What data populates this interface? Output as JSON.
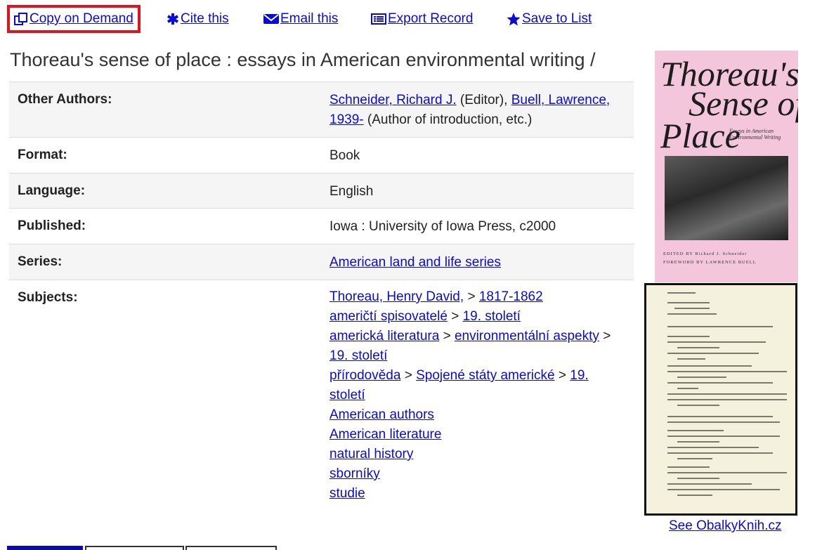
{
  "toolbar": {
    "copy_label": "Copy on Demand",
    "cite_label": "Cite this",
    "email_label": "Email this",
    "export_label": "Export Record",
    "save_label": "Save to List"
  },
  "record": {
    "title": "Thoreau's sense of place : essays in American environmental writing /",
    "other_authors_label": "Other Authors:",
    "author1": "Schneider, Richard J.",
    "author1_role": "(Editor),",
    "author2": "Buell, Lawrence, 1939-",
    "author2_role": "(Author of introduction, etc.)",
    "format_label": "Format:",
    "format_value": "Book",
    "language_label": "Language:",
    "language_value": "English",
    "published_label": "Published:",
    "published_value": "Iowa : University of Iowa Press, c2000",
    "series_label": "Series:",
    "series_value": "American land and life series",
    "subjects_label": "Subjects:",
    "subjects": {
      "s1a": "Thoreau, Henry David,",
      "s1b": "1817-1862",
      "s2a": "američtí spisovatelé",
      "s2b": "19. století",
      "s3a": "americká literatura",
      "s3b": "environmentální aspekty",
      "s3c": "19. století",
      "s4a": "přírodověda",
      "s4b": "Spojené státy americké",
      "s4c": "19. století",
      "s5": "American authors",
      "s6": "American literature",
      "s7": "natural history",
      "s8": "sborníky",
      "s9": "studie"
    },
    "separator": ">"
  },
  "cover": {
    "title_line1": "Thoreau's",
    "title_line2": "Sense of",
    "title_line3": "Place",
    "subtitle": "Essays in American Environmental Writing",
    "editor_line": "EDITED BY Richard J. Schneider",
    "foreword_line": "FOREWORD BY LAWRENCE BUELL",
    "see_link": "See ObalkyKnih.cz"
  },
  "colors": {
    "link": "#0a0ad8",
    "highlight_border": "#e0141e",
    "cover_pink": "#f3c6dc",
    "toc_paper": "#f4f1dc",
    "active_tab": "#0b0ba8"
  }
}
